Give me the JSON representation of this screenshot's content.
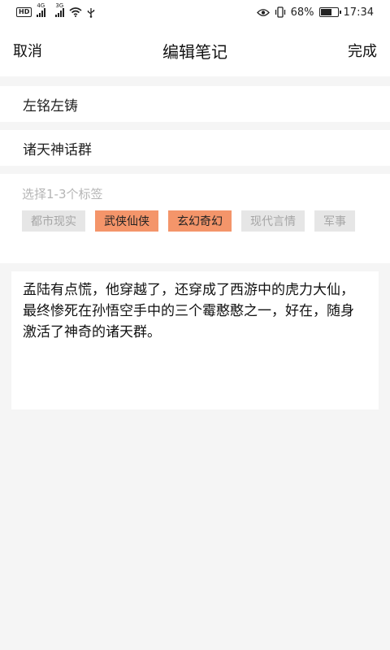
{
  "status_bar": {
    "hd_label": "HD",
    "signal1_gen": "4G",
    "signal2_gen": "3G",
    "battery_percent": "68%",
    "battery_level": 0.68,
    "time": "17:34",
    "icons": [
      "hd-icon",
      "signal-icon",
      "wifi-icon",
      "usb-icon",
      "eye-icon",
      "vibrate-icon",
      "battery-icon"
    ]
  },
  "header": {
    "cancel_label": "取消",
    "title": "编辑笔记",
    "done_label": "完成"
  },
  "fields": {
    "title_value": "左铭左铸",
    "group_value": "诸天神话群"
  },
  "tags": {
    "hint": "选择1-3个标签",
    "items": [
      {
        "label": "都市现实",
        "selected": false
      },
      {
        "label": "武侠仙侠",
        "selected": true
      },
      {
        "label": "玄幻奇幻",
        "selected": true
      },
      {
        "label": "现代言情",
        "selected": false
      },
      {
        "label": "军事",
        "selected": false
      }
    ]
  },
  "content": {
    "text": "孟陆有点慌，他穿越了，还穿成了西游中的虎力大仙，最终惨死在孙悟空手中的三个霉憨憨之一，好在，随身激活了神奇的诸天群。"
  },
  "colors": {
    "tag_selected_bg": "#f4956a",
    "tag_unselected_bg": "#e6e6e6",
    "tag_unselected_text": "#a6a6a6",
    "page_bg": "#f5f5f5"
  }
}
